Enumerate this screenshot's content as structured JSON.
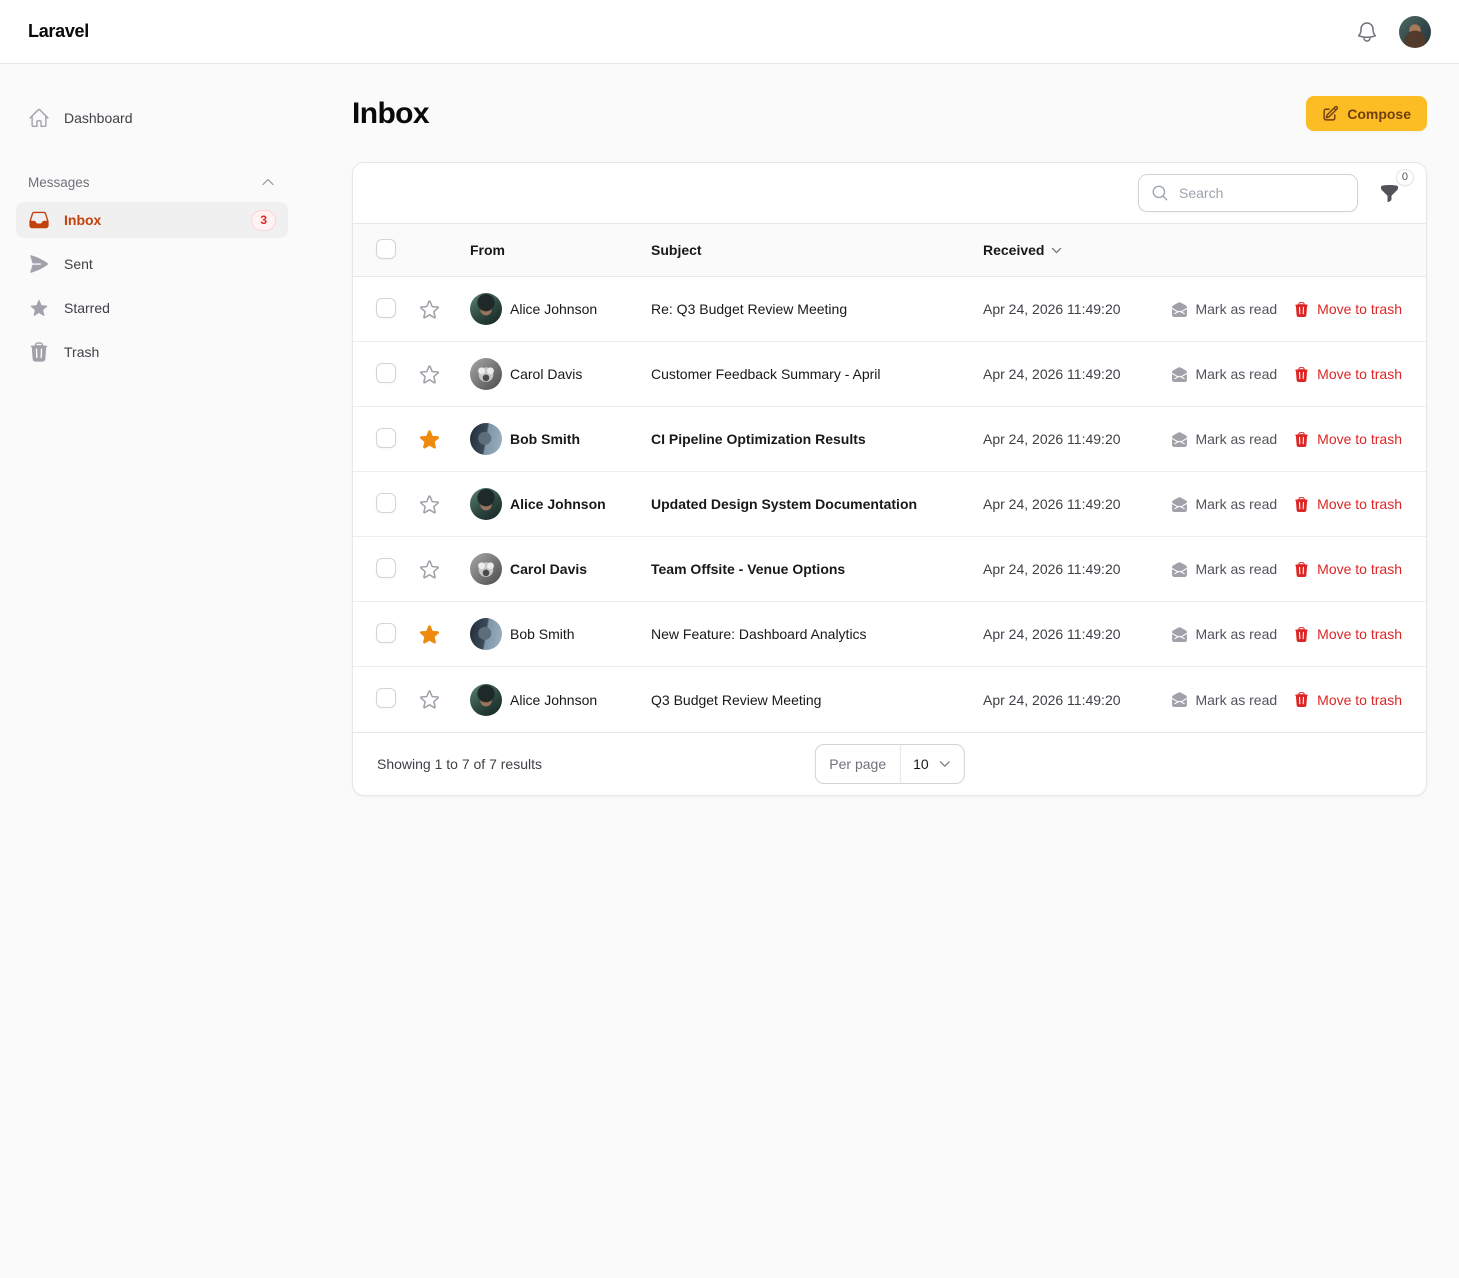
{
  "topbar": {
    "logo": "Laravel"
  },
  "sidebar": {
    "dashboard": {
      "label": "Dashboard",
      "icon": "home-icon"
    },
    "group": {
      "label": "Messages",
      "icon": "chevron-up-icon"
    },
    "items": [
      {
        "label": "Inbox",
        "icon": "inbox-icon",
        "badge": "3",
        "active": true
      },
      {
        "label": "Sent",
        "icon": "paper-plane-icon",
        "badge": null,
        "active": false
      },
      {
        "label": "Starred",
        "icon": "star-icon",
        "badge": null,
        "active": false
      },
      {
        "label": "Trash",
        "icon": "trash-icon",
        "badge": null,
        "active": false
      }
    ]
  },
  "page": {
    "title": "Inbox",
    "compose_label": "Compose"
  },
  "table": {
    "search_placeholder": "Search",
    "filter_count": "0",
    "columns": {
      "from": "From",
      "subject": "Subject",
      "received": "Received"
    },
    "row_actions": {
      "mark_read": "Mark as read",
      "trash": "Move to trash"
    },
    "rows": [
      {
        "from": "Alice Johnson",
        "subject": "Re: Q3 Budget Review Meeting",
        "received": "Apr 24, 2026 11:49:20",
        "unread": false,
        "starred": false,
        "avatar": "alice"
      },
      {
        "from": "Carol Davis",
        "subject": "Customer Feedback Summary - April",
        "received": "Apr 24, 2026 11:49:20",
        "unread": false,
        "starred": false,
        "avatar": "carol"
      },
      {
        "from": "Bob Smith",
        "subject": "CI Pipeline Optimization Results",
        "received": "Apr 24, 2026 11:49:20",
        "unread": true,
        "starred": true,
        "avatar": "bob"
      },
      {
        "from": "Alice Johnson",
        "subject": "Updated Design System Documentation",
        "received": "Apr 24, 2026 11:49:20",
        "unread": true,
        "starred": false,
        "avatar": "alice"
      },
      {
        "from": "Carol Davis",
        "subject": "Team Offsite - Venue Options",
        "received": "Apr 24, 2026 11:49:20",
        "unread": true,
        "starred": false,
        "avatar": "carol"
      },
      {
        "from": "Bob Smith",
        "subject": "New Feature: Dashboard Analytics",
        "received": "Apr 24, 2026 11:49:20",
        "unread": false,
        "starred": true,
        "avatar": "bob"
      },
      {
        "from": "Alice Johnson",
        "subject": "Q3 Budget Review Meeting",
        "received": "Apr 24, 2026 11:49:20",
        "unread": false,
        "starred": false,
        "avatar": "alice"
      }
    ],
    "footer": {
      "summary": "Showing 1 to 7 of 7 results",
      "per_page_label": "Per page",
      "per_page_value": "10"
    }
  },
  "colors": {
    "accent_button": "#fbbd23",
    "accent_button_text": "#713f12",
    "active_nav": "#c2410c",
    "danger": "#dc2626",
    "star_filled": "#ee8b0e",
    "page_background": "#fafafa",
    "card_border": "#e7e7e9"
  }
}
